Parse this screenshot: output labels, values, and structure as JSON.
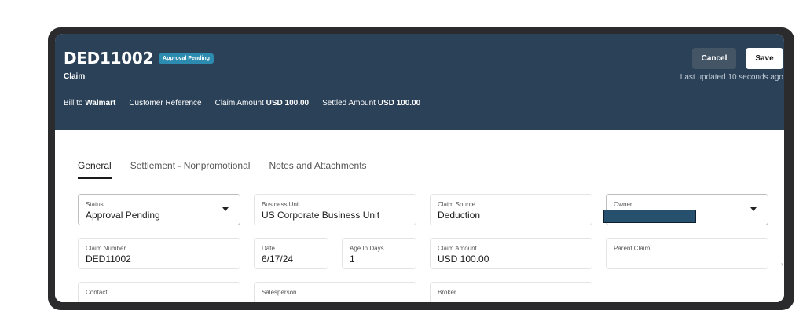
{
  "header": {
    "claim_id": "DED11002",
    "status_badge": "Approval Pending",
    "subtitle": "Claim",
    "summary": {
      "bill_to_label": "Bill to",
      "bill_to_value": "Walmart",
      "customer_reference_label": "Customer Reference",
      "claim_amount_label": "Claim Amount",
      "claim_amount_value": "USD 100.00",
      "settled_amount_label": "Settled Amount",
      "settled_amount_value": "USD 100.00"
    },
    "cancel_label": "Cancel",
    "save_label": "Save",
    "last_updated": "Last updated 10 seconds ago"
  },
  "tabs": [
    {
      "label": "General",
      "active": true
    },
    {
      "label": "Settlement - Nonpromotional",
      "active": false
    },
    {
      "label": "Notes and Attachments",
      "active": false
    }
  ],
  "fields": {
    "status": {
      "label": "Status",
      "value": "Approval Pending"
    },
    "business_unit": {
      "label": "Business Unit",
      "value": "US Corporate Business Unit"
    },
    "claim_source": {
      "label": "Claim Source",
      "value": "Deduction"
    },
    "owner": {
      "label": "Owner",
      "value": ""
    },
    "claim_number": {
      "label": "Claim Number",
      "value": "DED11002"
    },
    "date": {
      "label": "Date",
      "value": "6/17/24"
    },
    "age_in_days": {
      "label": "Age In Days",
      "value": "1"
    },
    "claim_amount": {
      "label": "Claim Amount",
      "value": "USD 100.00"
    },
    "parent_claim": {
      "label": "Parent Claim",
      "value": ""
    },
    "contact": {
      "label": "Contact",
      "value": ""
    },
    "salesperson": {
      "label": "Salesperson",
      "value": ""
    },
    "broker": {
      "label": "Broker",
      "value": ""
    }
  },
  "colors": {
    "header_bg": "#2a4158",
    "badge_bg": "#2e8bb0",
    "frame": "#2b2b2d"
  },
  "icons": {
    "dropdown": "chevron-down-icon",
    "edge": "chevron-right-icon"
  },
  "edge_chevron": "›"
}
